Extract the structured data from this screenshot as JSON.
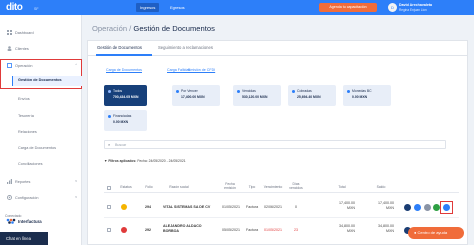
{
  "topbar": {
    "logo": "dito",
    "logo_sub": "SF",
    "tabs": [
      "Ingresos",
      "Egresos"
    ],
    "schedule_button": "Agenda tu capacitación",
    "user_initial": "D",
    "user_name": "David Arechavaleta",
    "user_company": "Regina Enjuan Lion"
  },
  "sidebar": {
    "dashboard": "Dashboard",
    "clientes": "Clientes",
    "operacion": "Operación",
    "gestion_documentos": "Gestión de Documentos",
    "envios": "Envíos",
    "tesoreria": "Tesorería",
    "relaciones": "Relaciones",
    "carga_documentos": "Carga de Documentos",
    "conciliaciones": "Conciliaciones",
    "reportes": "Reportes",
    "configuracion": "Configuración",
    "brand_prefix": "Conectado",
    "brand_name": "Interfactura"
  },
  "breadcrumb": {
    "section": "Operación",
    "separator": "/",
    "current": "Gestión de Documentos"
  },
  "main_tabs": [
    "Gestión de Documentos",
    "Seguimiento a reclamaciones"
  ],
  "sub_links": [
    "Carga de Documentos",
    "Carga Fallidas",
    "Emisión de CFDI"
  ],
  "cards": [
    {
      "label": "Todos",
      "value": "700,434.05 MXN"
    },
    {
      "label": "Por Vencer",
      "value": "17,400.00 MXN"
    },
    {
      "label": "Vencidas",
      "value": "530,120.00 MXN"
    },
    {
      "label": "Cobradas",
      "value": "25,694.40 MXN"
    },
    {
      "label": "Monedas BC",
      "value": "0.00 MXN"
    },
    {
      "label": "Financiadas",
      "value": "0.00 MXN"
    }
  ],
  "search": {
    "placeholder": "Buscar"
  },
  "filters": {
    "label": "Filtros aplicados:",
    "range": "Fecha: 24/05/2020 - 24/05/2021"
  },
  "table": {
    "headers": [
      "Estatus",
      "Folio",
      "Razón social",
      "Fecha emisión",
      "Tipo",
      "Vencimiento",
      "Días vencidos",
      "Total",
      "Saldo"
    ],
    "rows": [
      {
        "folio": "294",
        "razon": "VITAL SISTEMAS SA DE CV",
        "fecha": "01/05/2021",
        "tipo": "Factura",
        "venc": "02/06/2021",
        "dias": "0",
        "total": "17,400.00 MXN",
        "saldo": "17,400.00 MXN",
        "status_color": "#f5b400"
      },
      {
        "folio": "292",
        "razon": "ALEJANDRO ALDACO BORBOA",
        "fecha": "05/05/2021",
        "tipo": "Factura",
        "venc": "01/05/2021",
        "dias": "23",
        "total": "34,800.00 MXN",
        "saldo": "34,800.00 MXN",
        "status_color": "#e03a3a"
      }
    ]
  },
  "chat": "Chat en línea",
  "help": "Centro de ayuda"
}
